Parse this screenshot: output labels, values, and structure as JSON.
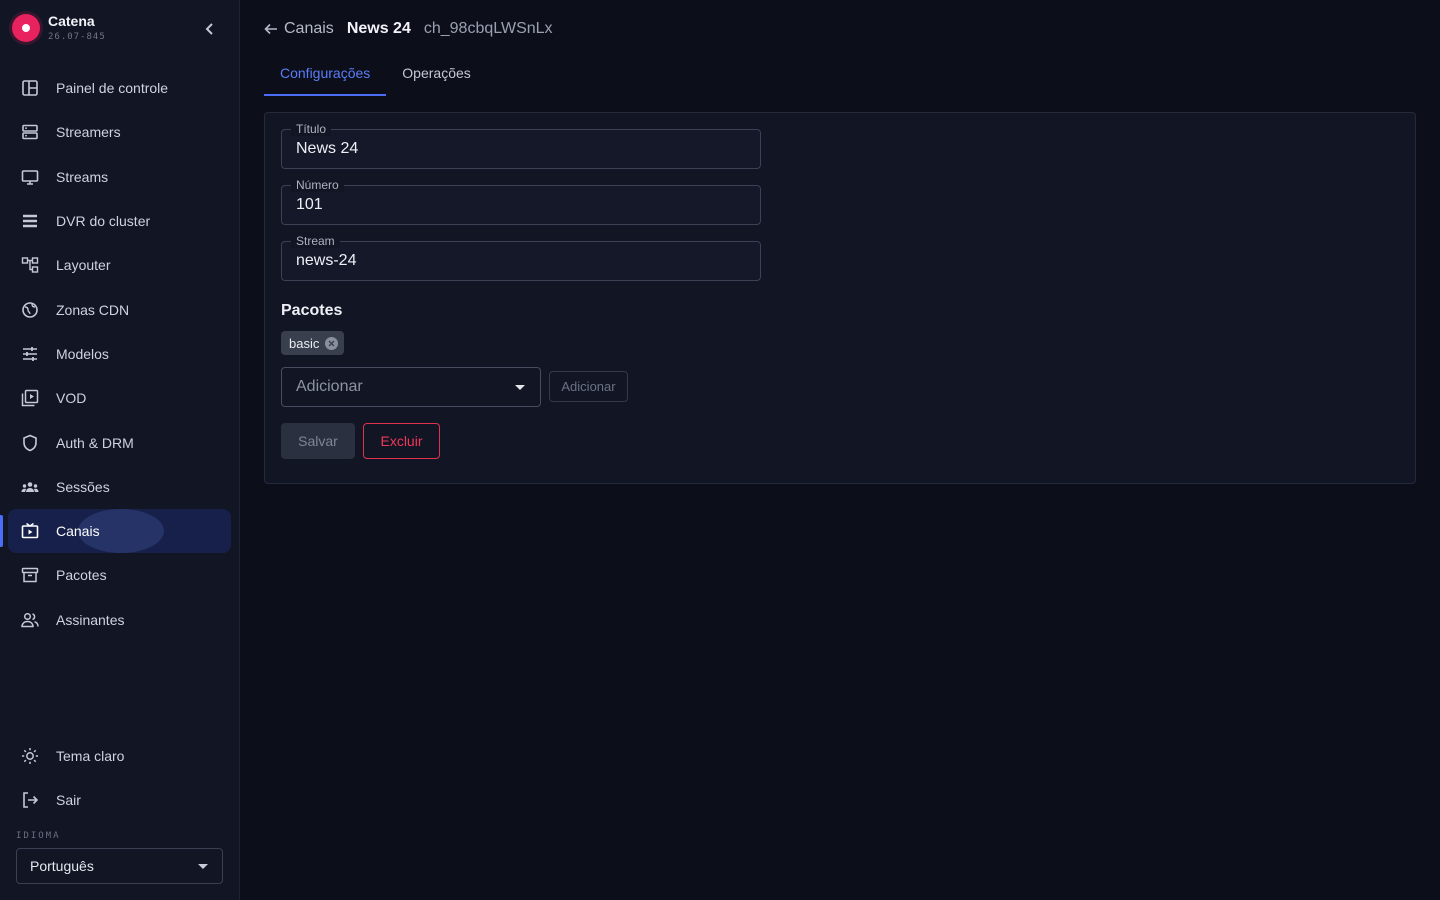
{
  "brand": {
    "name": "Catena",
    "version": "26.07-845",
    "accent": "#e8215f"
  },
  "sidebar": {
    "items": [
      {
        "label": "Painel de controle",
        "icon": "dashboard-icon"
      },
      {
        "label": "Streamers",
        "icon": "server-icon"
      },
      {
        "label": "Streams",
        "icon": "monitor-icon"
      },
      {
        "label": "DVR do cluster",
        "icon": "storage-list-icon"
      },
      {
        "label": "Layouter",
        "icon": "layout-tree-icon"
      },
      {
        "label": "Zonas CDN",
        "icon": "globe-icon"
      },
      {
        "label": "Modelos",
        "icon": "sliders-icon"
      },
      {
        "label": "VOD",
        "icon": "video-library-icon"
      },
      {
        "label": "Auth & DRM",
        "icon": "shield-icon"
      },
      {
        "label": "Sessões",
        "icon": "group-icon"
      },
      {
        "label": "Canais",
        "icon": "tv-icon",
        "active": true
      },
      {
        "label": "Pacotes",
        "icon": "archive-icon"
      },
      {
        "label": "Assinantes",
        "icon": "people-icon"
      }
    ],
    "bottom": [
      {
        "label": "Tema claro",
        "icon": "sun-icon"
      },
      {
        "label": "Sair",
        "icon": "logout-icon"
      }
    ],
    "language": {
      "label": "IDIOMA",
      "value": "Português"
    }
  },
  "header": {
    "back_label": "Canais",
    "title": "News 24",
    "channel_id": "ch_98cbqLWSnLx"
  },
  "tabs": [
    {
      "label": "Configurações",
      "active": true
    },
    {
      "label": "Operações",
      "active": false
    }
  ],
  "form": {
    "title": {
      "label": "Título",
      "value": "News 24"
    },
    "number": {
      "label": "Número",
      "value": "101"
    },
    "stream": {
      "label": "Stream",
      "value": "news-24"
    },
    "packages": {
      "heading": "Pacotes",
      "chips": [
        "basic"
      ],
      "select_placeholder": "Adicionar",
      "add_button": "Adicionar"
    },
    "save_button": "Salvar",
    "delete_button": "Excluir"
  },
  "colors": {
    "primary": "#4a6cf7",
    "danger": "#e0314e",
    "background": "#0c0f1a",
    "surface": "#111524"
  }
}
